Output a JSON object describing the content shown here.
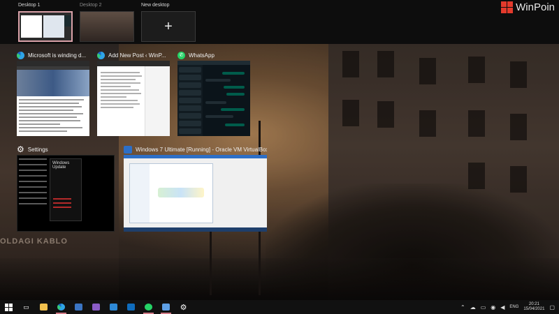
{
  "desktops": [
    {
      "label": "Desktop 1",
      "active": true
    },
    {
      "label": "Desktop 2",
      "active": false
    },
    {
      "label": "New desktop",
      "icon": "plus-icon"
    }
  ],
  "new_desktop_plus": "+",
  "brand": {
    "name": "WinPoin"
  },
  "windows": {
    "edge_article": {
      "title": "Microsoft is winding d..."
    },
    "wp_editor": {
      "title": "Add New Post ‹ WinP..."
    },
    "whatsapp": {
      "title": "WhatsApp"
    },
    "settings": {
      "title": "Settings",
      "panel_heading": "Windows Update"
    },
    "virtualbox": {
      "title": "Windows 7 Ultimate [Running] - Oracle VM VirtualBox"
    }
  },
  "wallpaper": {
    "sign_text": "OLDAGI KABLO"
  },
  "taskbar": {
    "items": [
      {
        "name": "start-button",
        "icon": "windows-logo-icon"
      },
      {
        "name": "task-view-button",
        "icon": "task-view-icon"
      },
      {
        "name": "file-explorer",
        "icon": "folder-icon",
        "active": false
      },
      {
        "name": "edge",
        "icon": "edge-icon",
        "active": true
      },
      {
        "name": "virtualbox",
        "icon": "virtualbox-icon",
        "active": false
      },
      {
        "name": "visual-studio",
        "icon": "visual-studio-icon",
        "active": false
      },
      {
        "name": "photos",
        "icon": "photos-icon",
        "active": false
      },
      {
        "name": "outlook",
        "icon": "outlook-icon",
        "active": false
      },
      {
        "name": "whatsapp",
        "icon": "whatsapp-icon",
        "active": true
      },
      {
        "name": "vbox-vm",
        "icon": "vbox-vm-icon",
        "active": true
      },
      {
        "name": "settings",
        "icon": "gear-icon",
        "active": false
      }
    ],
    "tray": {
      "language": "ENG",
      "time": "20:21",
      "date": "15/04/2021"
    }
  },
  "colors": {
    "accent_active_desktop": "#d9a1a8",
    "taskbar_indicator": "#d27a86",
    "brand_red": "#e33a2c",
    "whatsapp_green": "#25d366"
  }
}
